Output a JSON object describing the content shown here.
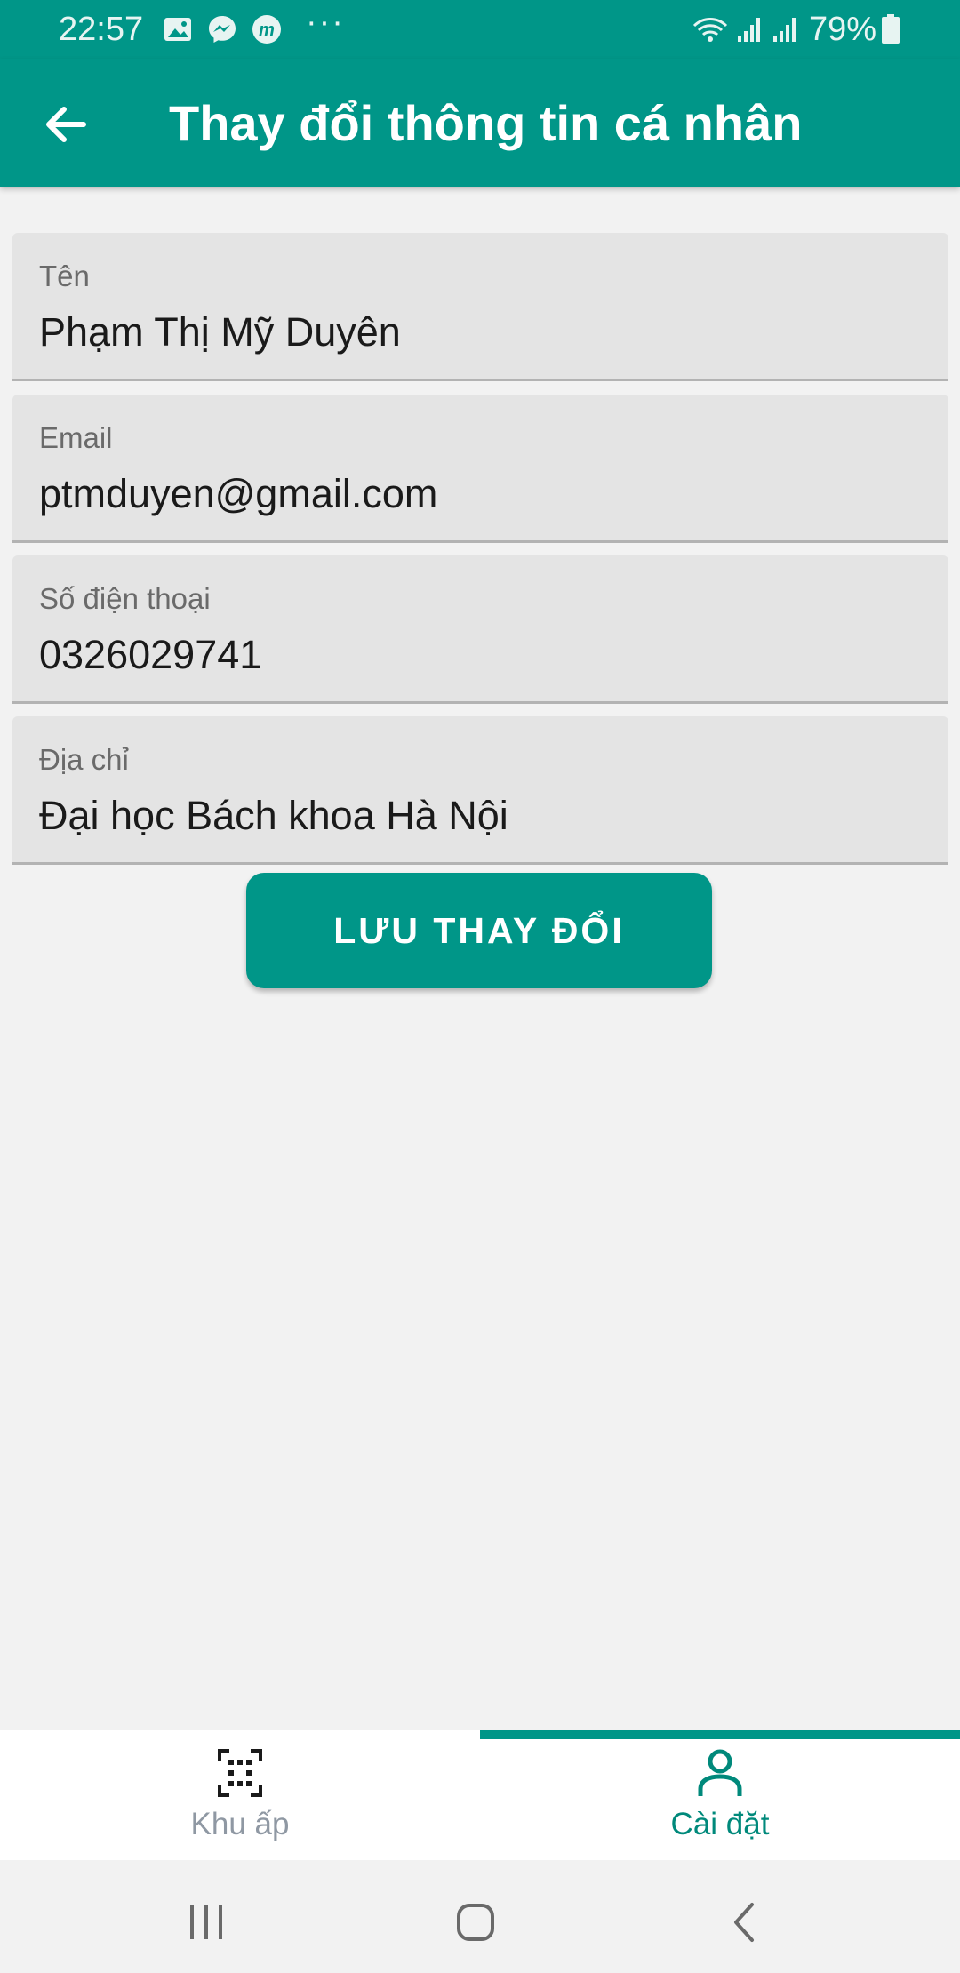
{
  "status_bar": {
    "time": "22:57",
    "battery": "79%",
    "more": "···"
  },
  "app_bar": {
    "title": "Thay đổi thông tin cá nhân"
  },
  "form": {
    "fields": [
      {
        "label": "Tên",
        "value": "Phạm Thị Mỹ Duyên"
      },
      {
        "label": "Email",
        "value": "ptmduyen@gmail.com"
      },
      {
        "label": "Số điện thoại",
        "value": "0326029741"
      },
      {
        "label": "Địa chỉ",
        "value": "Đại học Bách khoa Hà Nội"
      }
    ],
    "save_label": "LƯU THAY ĐỔI"
  },
  "bottom_nav": {
    "items": [
      {
        "label": "Khu ấp",
        "icon": "qr-scan-icon",
        "active": false
      },
      {
        "label": "Cài đặt",
        "icon": "person-icon",
        "active": true
      }
    ]
  },
  "colors": {
    "primary": "#009688",
    "active_tab": "#00897b",
    "inactive_tab": "#8f98a3",
    "field_bg": "#e4e4e4"
  }
}
